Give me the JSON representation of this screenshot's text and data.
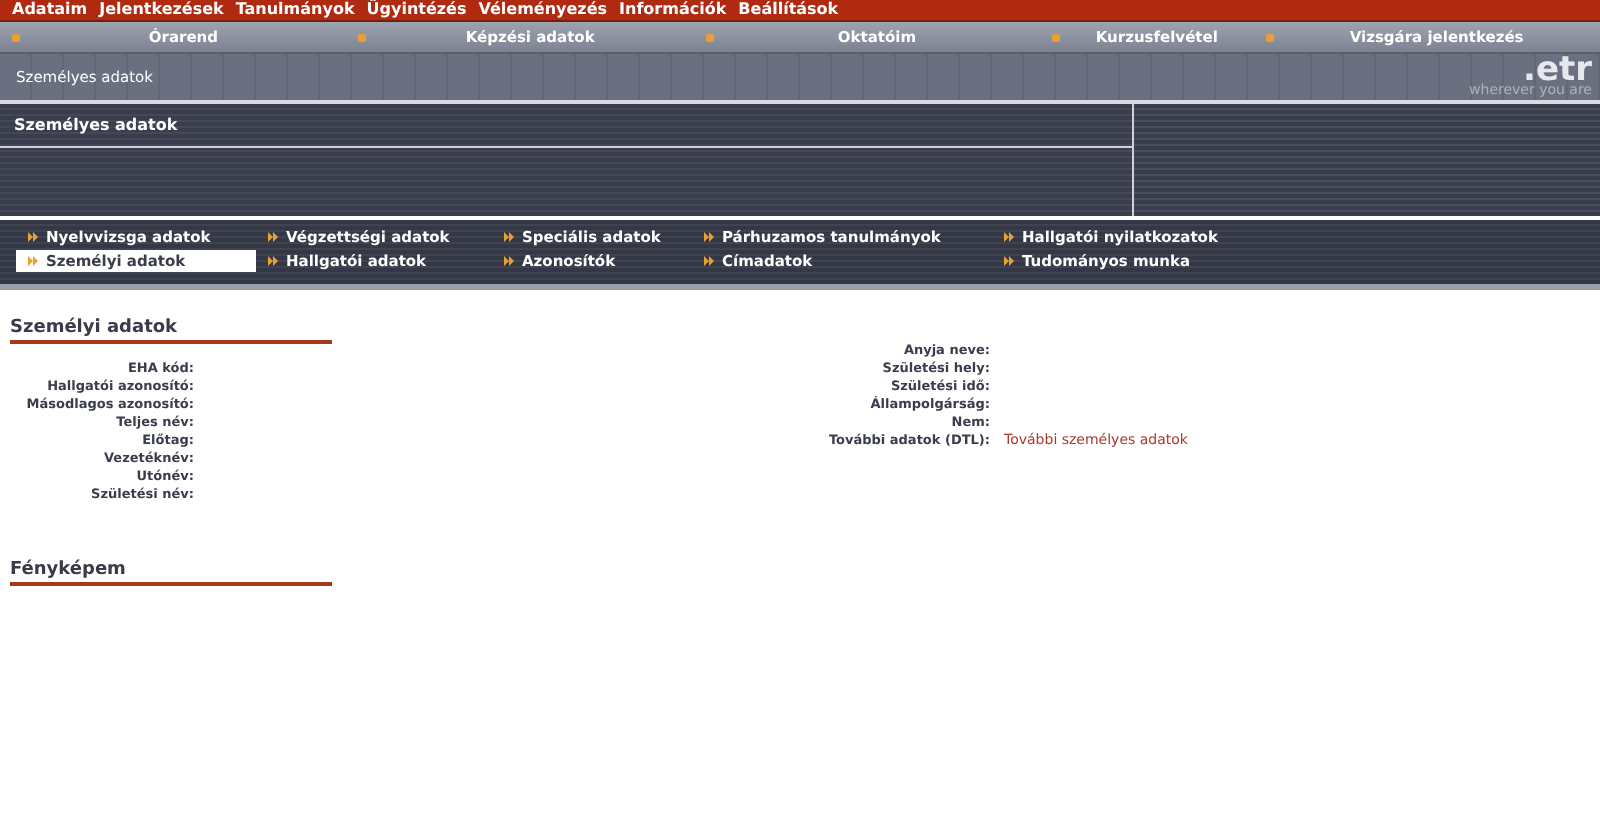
{
  "top_menu": [
    "Adataim",
    "Jelentkezések",
    "Tanulmányok",
    "Ügyintézés",
    "Véleményezés",
    "Információk",
    "Beállítások"
  ],
  "main_nav": [
    "Órarend",
    "Képzési adatok",
    "Oktatóim",
    "Kurzusfelvétel",
    "Vizsgára jelentkezés"
  ],
  "breadcrumb": "Személyes adatok",
  "logo": {
    "name": ".etr",
    "tagline": "wherever you are"
  },
  "panel_title": "Személyes adatok",
  "sub_tabs": [
    {
      "label": "Nyelvvizsga adatok",
      "selected": false
    },
    {
      "label": "Végzettségi adatok",
      "selected": false
    },
    {
      "label": "Speciális adatok",
      "selected": false
    },
    {
      "label": "Párhuzamos tanulmányok",
      "selected": false
    },
    {
      "label": "Hallgatói nyilatkozatok",
      "selected": false
    },
    {
      "label": "Személyi adatok",
      "selected": true
    },
    {
      "label": "Hallgatói adatok",
      "selected": false
    },
    {
      "label": "Azonosítók",
      "selected": false
    },
    {
      "label": "Címadatok",
      "selected": false
    },
    {
      "label": "Tudományos munka",
      "selected": false
    }
  ],
  "section_title": "Személyi adatok",
  "left_fields": [
    {
      "label": "EHA kód:"
    },
    {
      "label": "Hallgatói azonosító:"
    },
    {
      "label": "Másodlagos azonosító:"
    },
    {
      "label": "Teljes név:"
    },
    {
      "label": "Előtag:"
    },
    {
      "label": "Vezetéknév:"
    },
    {
      "label": "Utónév:"
    },
    {
      "label": "Születési név:"
    }
  ],
  "right_fields": [
    {
      "label": "Anyja neve:"
    },
    {
      "label": "Születési hely:"
    },
    {
      "label": "Születési idő:"
    },
    {
      "label": "Állampolgárság:"
    },
    {
      "label": "Nem:"
    },
    {
      "label": "További adatok (DTL):",
      "link": "További személyes adatok"
    }
  ],
  "photo_title": "Fényképem"
}
